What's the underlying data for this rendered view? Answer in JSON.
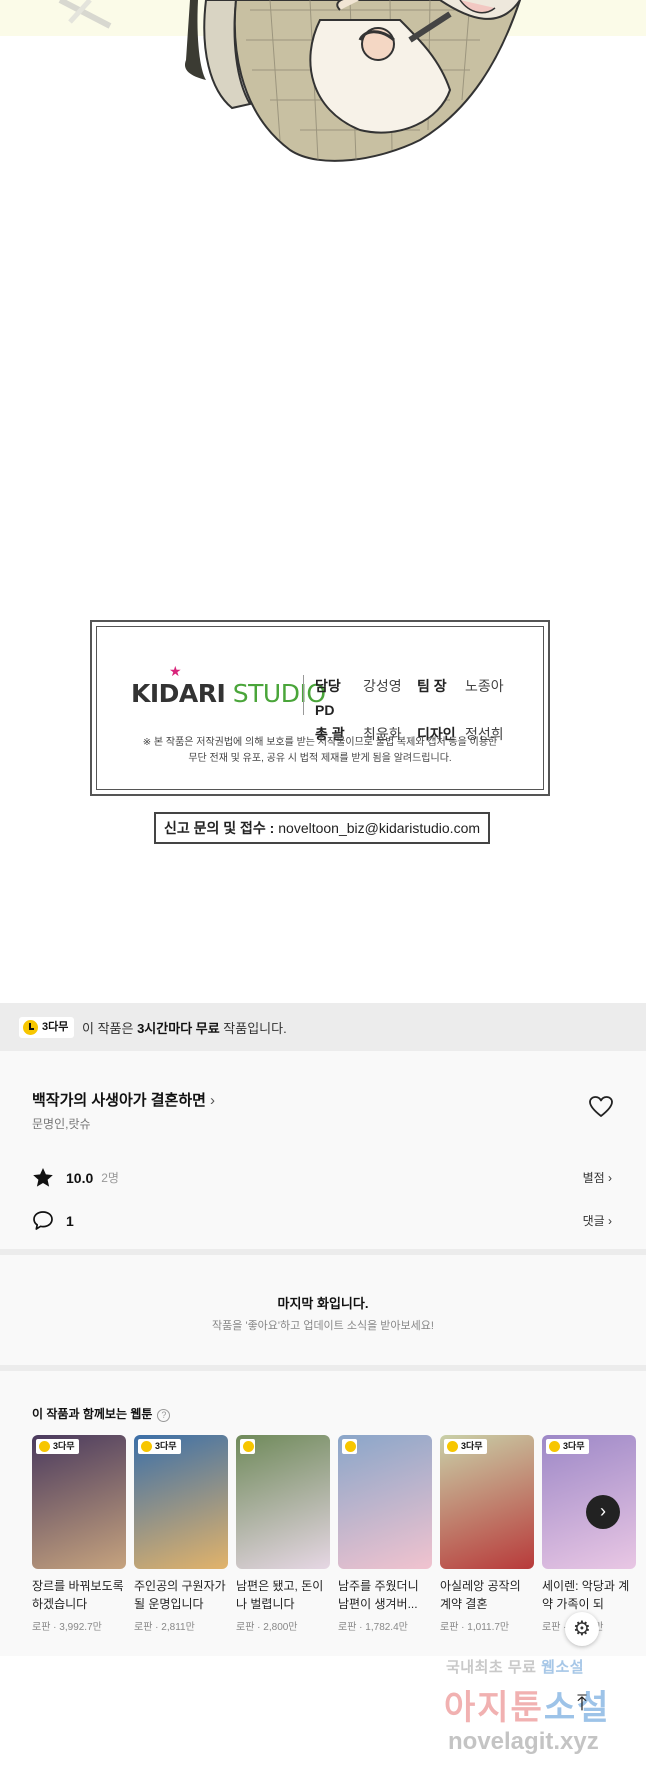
{
  "credits": {
    "logo_kid": "KIDARI",
    "logo_studio": "STUDIO",
    "staff": [
      {
        "role1": "담당 PD",
        "name1": "강성영",
        "role2": "팀 장",
        "name2": "노종아"
      },
      {
        "role1": "총 괄",
        "name1": "최윤화",
        "role2": "디자인",
        "name2": "정선희"
      }
    ],
    "notice_line1": "※ 본 작품은 저작권법에 의해 보호를 받는 저작물이므로 불법 복제와 캡처 등을 이용한",
    "notice_line2": "무단 전재 및 유포, 공유 시 법적 제재를 받게 됨을 알려드립니다.",
    "report_label": "신고 문의 및 접수 :",
    "report_email": "noveltoon_biz@kidaristudio.com"
  },
  "free_banner": {
    "badge": "3다무",
    "text_pre": "이 작품은 ",
    "text_bold": "3시간마다 무료",
    "text_post": " 작품입니다."
  },
  "work": {
    "title": "백작가의 사생아가 결혼하면",
    "authors": "문명인,랏슈",
    "score": "10.0",
    "rater_count": "2명",
    "rating_link": "별점",
    "comment_count": "1",
    "comment_link": "댓글"
  },
  "last_episode": {
    "title": "마지막 화입니다.",
    "subtitle": "작품을 '좋아요'하고 업데이트 소식을 받아보세요!"
  },
  "recommendations": {
    "heading": "이 작품과 함께보는 웹툰",
    "items": [
      {
        "badge": "3다무",
        "title": "장르를 바꿔보도록 하겠습니다",
        "meta": "로판 · 3,992.7만",
        "c1": "#4a3a5e",
        "c2": "#c6a37e"
      },
      {
        "badge": "3다무",
        "title": "주인공의 구원자가 될 운명입니다",
        "meta": "로판 · 2,811만",
        "c1": "#3b6fa8",
        "c2": "#e2b36a"
      },
      {
        "badge": "",
        "title": "남편은 됐고, 돈이나 벌렵니다",
        "meta": "로판 · 2,800만",
        "c1": "#6f8a5a",
        "c2": "#e6d7e4"
      },
      {
        "badge": "",
        "title": "남주를 주웠더니 남편이 생겨버...",
        "meta": "로판 · 1,782.4만",
        "c1": "#8aa6c9",
        "c2": "#f1c3cf"
      },
      {
        "badge": "3다무",
        "title": "아실레앙 공작의 계약 결혼",
        "meta": "로판 · 1,011.7만",
        "c1": "#c9d0a8",
        "c2": "#b83a3a"
      },
      {
        "badge": "3다무",
        "title": "세이렌: 악당과 계약 가족이 되",
        "meta": "로판 · 7,159만",
        "c1": "#9d88c7",
        "c2": "#e9c7e4"
      }
    ]
  },
  "watermark": {
    "line1_a": "국내최초 무료 ",
    "line1_b": "웹소설",
    "line2_a": "아지툰",
    "line2_b": "소설",
    "line3": "novelagit.xyz"
  },
  "icons": {
    "star": "star-icon",
    "heart": "heart-icon",
    "comment": "comment-bubble-icon",
    "gear": "gear-icon",
    "top": "arrow-up-icon",
    "next": "chevron-right-icon"
  }
}
